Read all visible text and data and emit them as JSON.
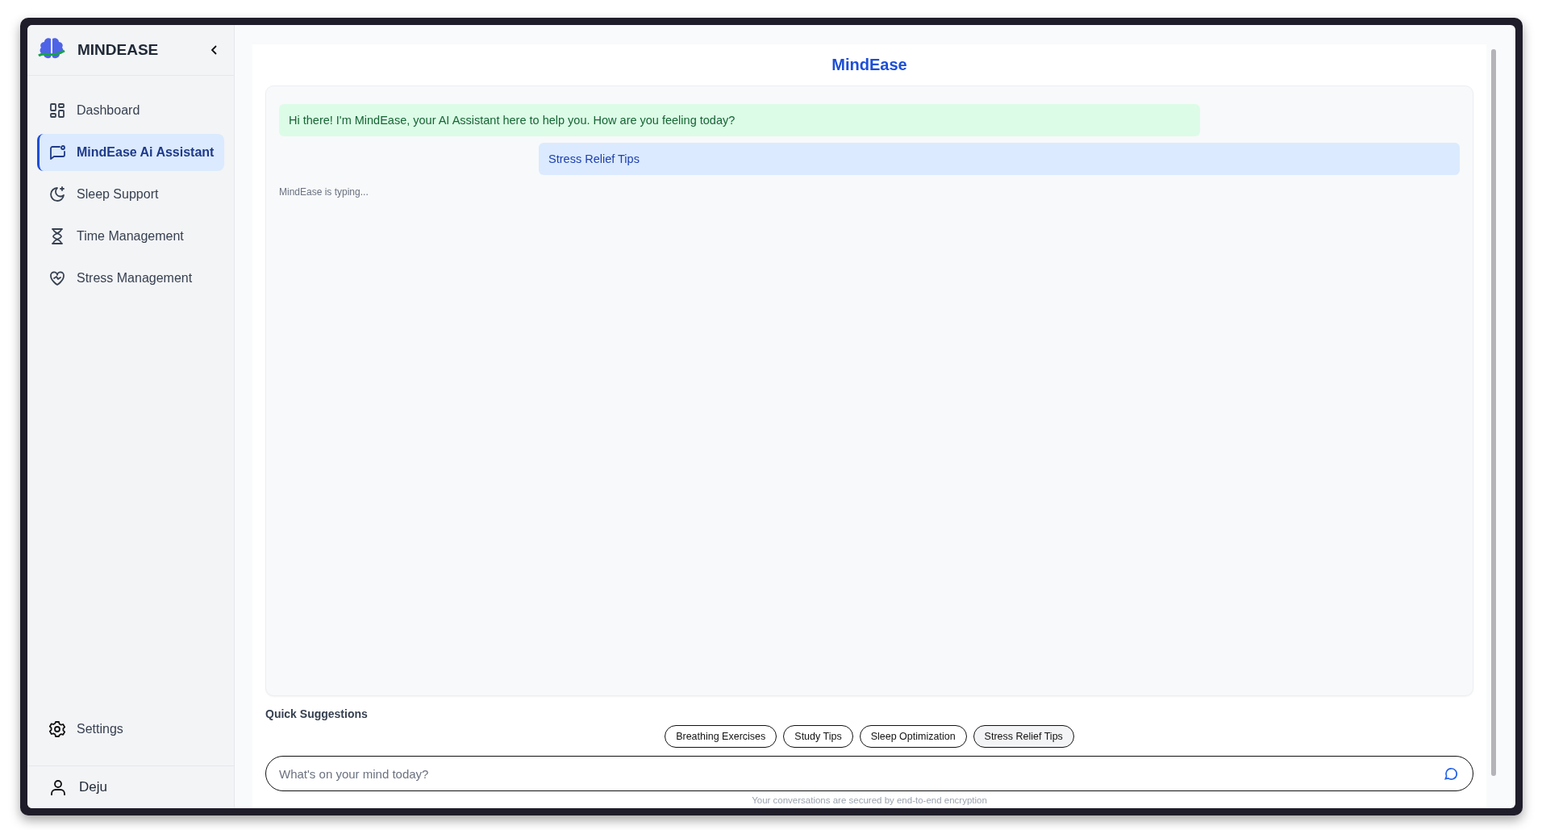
{
  "sidebar": {
    "brand": "MINDEASE",
    "items": [
      {
        "label": "Dashboard",
        "selected": false
      },
      {
        "label": "MindEase Ai Assistant",
        "selected": true
      },
      {
        "label": "Sleep Support",
        "selected": false
      },
      {
        "label": "Time Management",
        "selected": false
      },
      {
        "label": "Stress Management",
        "selected": false
      }
    ],
    "settings": "Settings",
    "user": "Deju"
  },
  "chat": {
    "title": "MindEase",
    "messages": [
      {
        "kind": "assistant",
        "text": "Hi there! I'm MindEase, your AI Assistant here to help you. How are you feeling today?"
      },
      {
        "kind": "user",
        "text": "Stress Relief Tips"
      }
    ],
    "typing": "MindEase is typing...",
    "suggestions_label": "Quick Suggestions",
    "suggestions": [
      {
        "label": "Breathing Exercises",
        "selected": false
      },
      {
        "label": "Study Tips",
        "selected": false
      },
      {
        "label": "Sleep Optimization",
        "selected": false
      },
      {
        "label": "Stress Relief Tips",
        "selected": true
      }
    ],
    "input": {
      "placeholder": "What's on your mind today?"
    },
    "footer": "Your conversations are secured by end-to-end encryption"
  }
}
